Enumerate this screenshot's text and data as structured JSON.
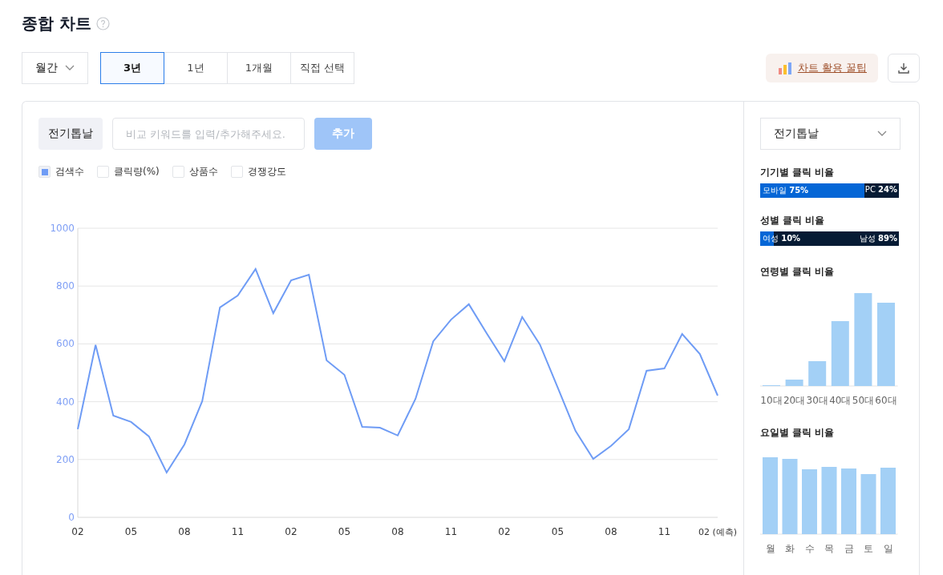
{
  "header": {
    "title": "종합 차트"
  },
  "period": {
    "dropdown": "월간",
    "tabs": [
      {
        "label": "3년",
        "selected": true
      },
      {
        "label": "1년",
        "selected": false
      },
      {
        "label": "1개월",
        "selected": false
      },
      {
        "label": "직접 선택",
        "selected": false
      }
    ]
  },
  "tips_button": "차트 활용 꿀팁",
  "keyword": {
    "chip": "전기톱날",
    "input_placeholder": "비교 키워드를 입력/추가해주세요.",
    "add_button": "추가",
    "add_disabled": true
  },
  "metrics": [
    {
      "label": "검색수",
      "checked": true
    },
    {
      "label": "클릭량(%)",
      "checked": false
    },
    {
      "label": "상품수",
      "checked": false
    },
    {
      "label": "경쟁강도",
      "checked": false
    }
  ],
  "chart": {
    "chart_data": {
      "type": "line",
      "categories": [
        "02",
        null,
        null,
        "05",
        null,
        null,
        "08",
        null,
        null,
        "11",
        null,
        null,
        "02",
        null,
        null,
        "05",
        null,
        null,
        "08",
        null,
        null,
        "11",
        null,
        null,
        "02",
        null,
        null,
        "05",
        null,
        null,
        "08",
        null,
        null,
        "11",
        null,
        null,
        "02 (예측)"
      ],
      "series": [
        {
          "color": "#6f9cf5",
          "values": [
            305,
            596,
            352,
            330,
            280,
            155,
            252,
            402,
            726,
            767,
            859,
            706,
            820,
            839,
            543,
            493,
            313,
            310,
            283,
            410,
            609,
            684,
            737,
            637,
            540,
            693,
            598,
            449,
            299,
            202,
            247,
            305,
            507,
            515,
            634,
            565,
            421
          ]
        }
      ],
      "grid": true,
      "ylim": [
        0,
        1000
      ],
      "yticks": [
        0,
        200,
        400,
        600,
        800,
        1000
      ]
    }
  },
  "side": {
    "dropdown": "전기톱날",
    "ratio_bars": [
      {
        "title": "기기별 클릭 비율",
        "left": "모바일 **75%**",
        "right": "PC **24%**",
        "level": 0.75
      },
      {
        "title": "성별 클릭 비율",
        "left": "여성 **10%**",
        "right": "남성 **89%**",
        "level": 0.1
      }
    ],
    "age": {
      "title": "연령별 클릭 비율",
      "labels": [
        "10대",
        "20대",
        "30대",
        "40대",
        "50대",
        "60대"
      ]
    },
    "weekday": {
      "title": "요일별 클릭 비율",
      "labels": [
        "월",
        "화",
        "수",
        "목",
        "금",
        "토",
        "일"
      ]
    }
  }
}
